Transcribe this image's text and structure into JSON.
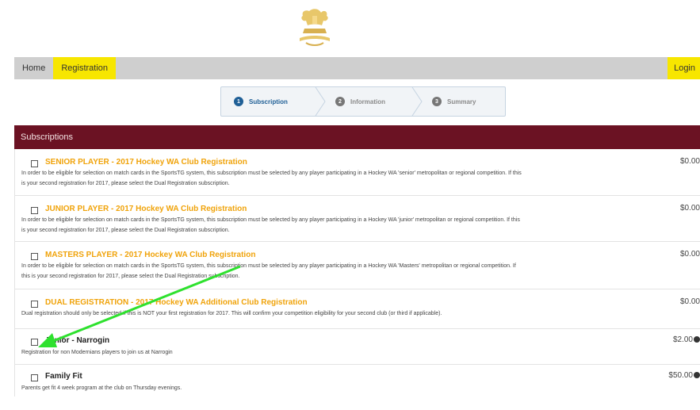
{
  "nav": {
    "home": "Home",
    "registration": "Registration",
    "login": "Login"
  },
  "steps": [
    {
      "number": "1",
      "label": "Subscription"
    },
    {
      "number": "2",
      "label": "Information"
    },
    {
      "number": "3",
      "label": "Summary"
    }
  ],
  "subscriptions": {
    "header": "Subscriptions",
    "items": [
      {
        "title": "SENIOR PLAYER - 2017 Hockey WA Club Registration",
        "desc_line1": "In order to be eligible for selection on match cards in the SportsTG system, this subscription must be selected by any player participating in a Hockey WA 'senior' metropolitan or regional competition. If this",
        "desc_line2": "is your second registration for 2017, please select the Dual Registration subscription.",
        "price": "$0.00"
      },
      {
        "title": "JUNIOR PLAYER - 2017 Hockey WA Club Registration",
        "desc_line1": "In order to be eligible for selection on match cards in the SportsTG system, this subscription must be selected by any player participating in a Hockey WA 'junior' metropolitan or regional competition. If this",
        "desc_line2": "is your second registration for 2017, please select the Dual Registration subscription.",
        "price": "$0.00"
      },
      {
        "title": "MASTERS PLAYER - 2017 Hockey WA Club Registration",
        "desc_line1": "In order to be eligible for selection on match cards in the SportsTG system, this subscription must be selected by any player participating in a Hockey WA 'Masters' metropolitan or regional competition. If",
        "desc_line2": "this is your second registration for 2017, please select the Dual Registration subscription.",
        "price": "$0.00"
      },
      {
        "title": "DUAL REGISTRATION - 2017 Hockey WA Additional Club Registration",
        "desc_line1": "Dual registration should only be selected if this is NOT your first registration for 2017. This will confirm your competition eligibility for your second club (or third if applicable).",
        "desc_line2": "",
        "price": "$0.00"
      },
      {
        "title": "Junior - Narrogin",
        "desc_line1": "Registration for non Modernians players to join us at Narrogin",
        "desc_line2": "",
        "price": "$2.00"
      },
      {
        "title": "Family Fit",
        "desc_line1": "Parents get fit 4 week program at the club on Thursday evenings.",
        "desc_line2": "",
        "price": "$50.00"
      }
    ]
  },
  "colors": {
    "accent_yellow": "#f7e600",
    "header_maroon": "#6b1223",
    "title_orange": "#f0a30a",
    "step_active": "#1f5f96",
    "annotation_arrow": "#2ee12e"
  },
  "icons": [
    "club-crest-icon",
    "checkbox-icon",
    "info-icon",
    "chevron-right-icon",
    "green-arrow-annotation"
  ]
}
